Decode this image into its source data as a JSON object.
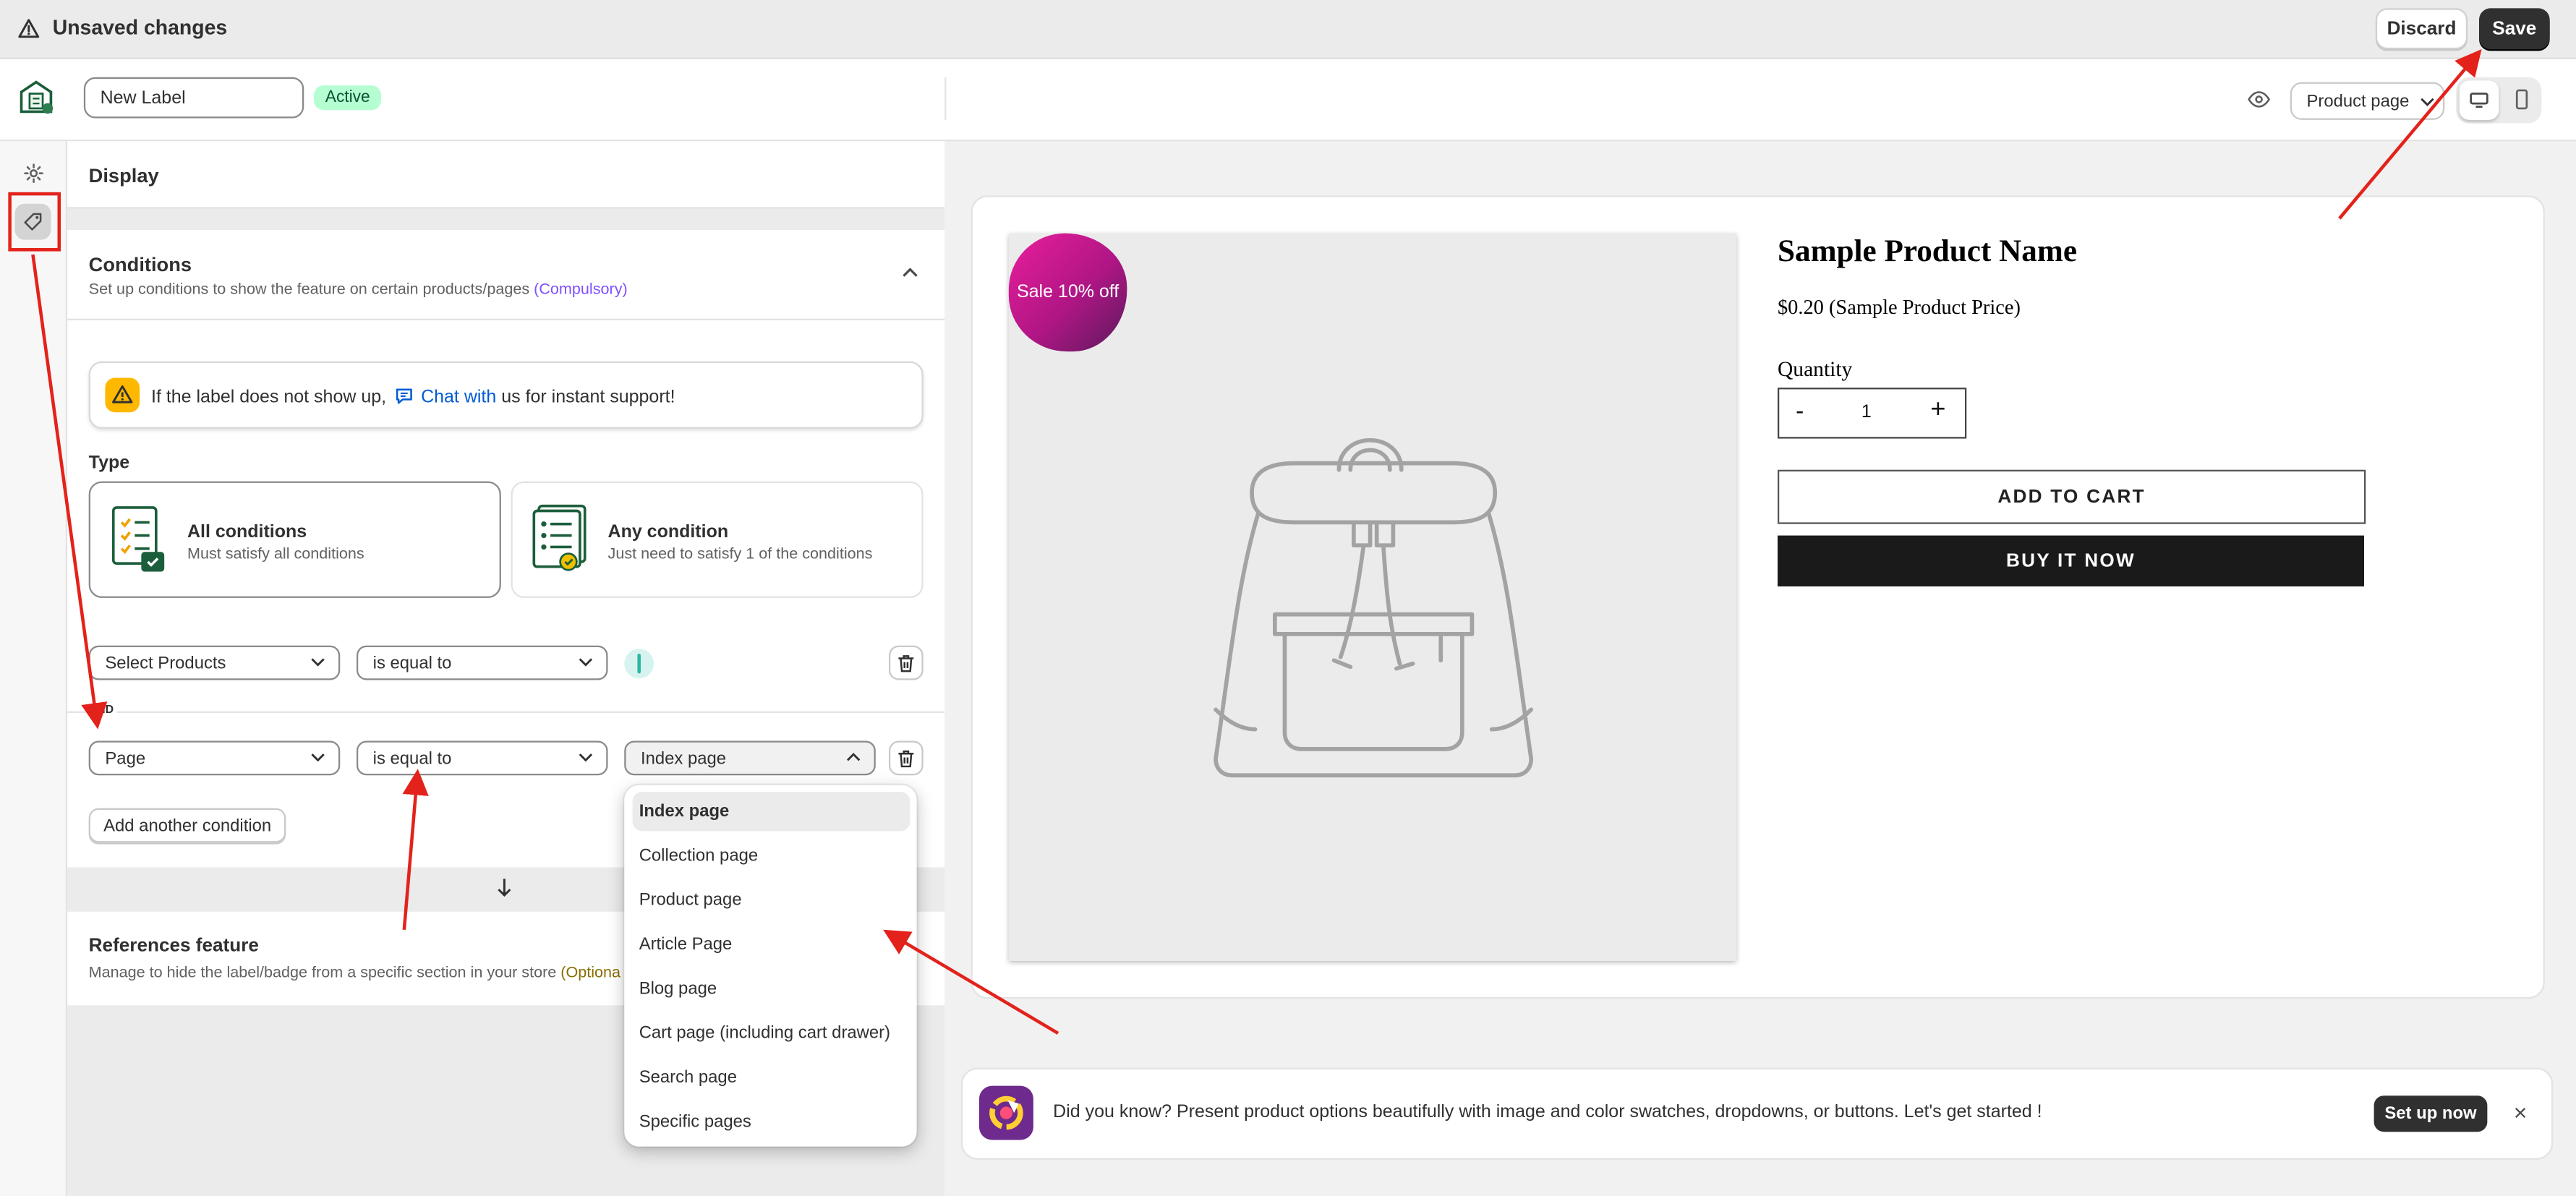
{
  "topbar": {
    "title": "Unsaved changes",
    "discard": "Discard",
    "save": "Save"
  },
  "header": {
    "label_name": "New Label",
    "status": "Active",
    "page_select": "Product page"
  },
  "display": {
    "title": "Display"
  },
  "conditions": {
    "title": "Conditions",
    "subtitle": "Set up conditions to show the feature on certain products/pages",
    "compulsory": "(Compulsory)",
    "notice_pre": "If the label does not show up,",
    "notice_link": "Chat with",
    "notice_post": "us for instant support!",
    "type_label": "Type",
    "all_title": "All conditions",
    "all_desc": "Must satisfy all conditions",
    "any_title": "Any condition",
    "any_desc": "Just need to satisfy 1 of the conditions",
    "row1": {
      "field": "Select Products",
      "operator": "is equal to"
    },
    "joiner": "AND",
    "row2": {
      "field": "Page",
      "operator": "is equal to",
      "value": "Index page"
    },
    "add_button": "Add another condition"
  },
  "references": {
    "title": "References feature",
    "subtitle": "Manage to hide the label/badge from a specific section in your store",
    "optional": "(Optiona"
  },
  "dropdown": {
    "options": [
      "Index page",
      "Collection page",
      "Product page",
      "Article Page",
      "Blog page",
      "Cart page (including cart drawer)",
      "Search page",
      "Specific pages"
    ]
  },
  "preview": {
    "sale_badge": "Sale 10% off",
    "product_name": "Sample Product Name",
    "price": "$0.20 (Sample Product Price)",
    "quantity_label": "Quantity",
    "qty_minus": "-",
    "qty_value": "1",
    "qty_plus": "+",
    "add_to_cart": "ADD TO CART",
    "buy_now": "BUY IT NOW"
  },
  "banner": {
    "text": "Did you know? Present product options beautifully with image and color swatches, dropdowns, or buttons. Let's get started !",
    "cta": "Set up now",
    "close": "×"
  },
  "colors": {
    "accent": "#303030",
    "active_badge": "#b4fed2",
    "link": "#005bd3",
    "compulsory": "#8051ff",
    "annotation": "#e3221b",
    "sale_badge": "#c2188a"
  }
}
